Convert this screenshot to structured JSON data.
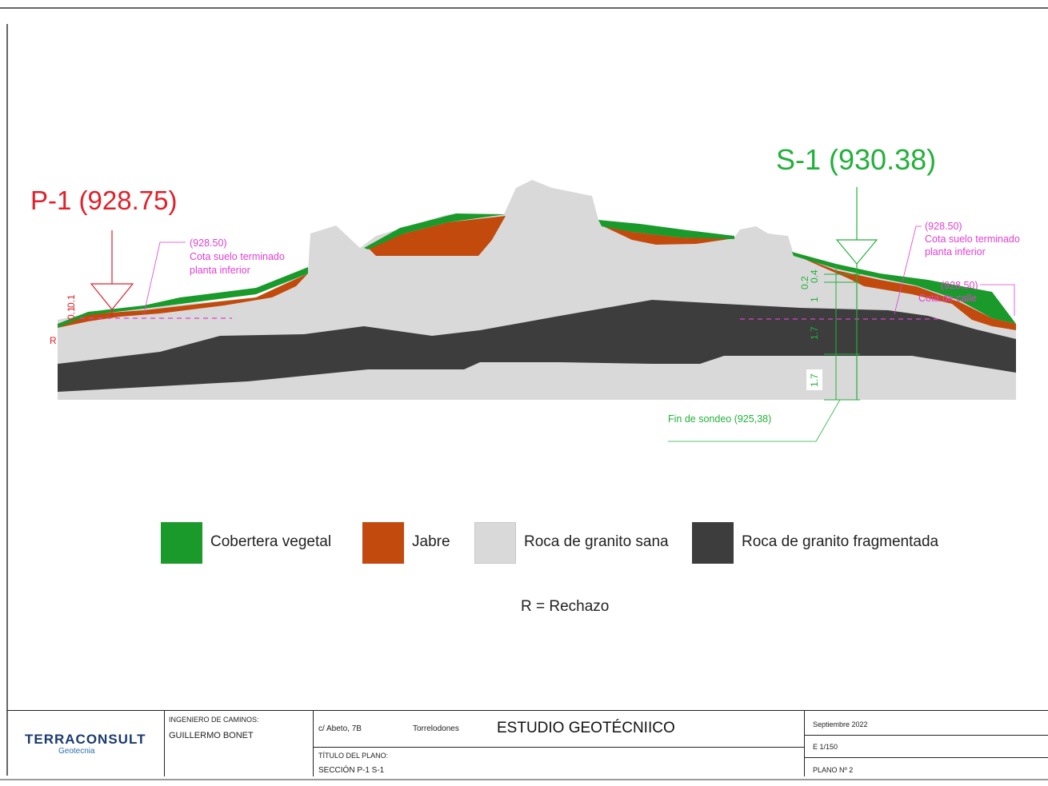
{
  "labels": {
    "p1": "P-1 (928.75)",
    "s1": "S-1 (930.38)",
    "left_cota_value": "(928.50)",
    "left_cota_line1": "Cota suelo terminado",
    "left_cota_line2": "planta inferior",
    "right_cota_value": "(928.50)",
    "right_cota_line1": "Cota suelo terminado",
    "right_cota_line2": "planta inferior",
    "calle_value": "(928.50)",
    "calle_text": "Cota de calle",
    "fin_sondeo": "Fin de sondeo (925,38)",
    "rechazo_marker": "R",
    "p1_dim_a": "0.1",
    "p1_dim_b": "0.1",
    "s1_dims": [
      "0.2",
      "0.4",
      "1",
      "1.7",
      "1.7"
    ]
  },
  "legend": [
    {
      "label": "Cobertera vegetal",
      "color": "#1a9a2a"
    },
    {
      "label": "Jabre",
      "color": "#c24a0c"
    },
    {
      "label": "Roca de granito sana",
      "color": "#d9d9d9"
    },
    {
      "label": "Roca de granito fragmentada",
      "color": "#3d3d3d"
    }
  ],
  "note": "R = Rechazo",
  "title_block": {
    "logo": "TERRACONSULT",
    "logo_sub": "Geotecnia",
    "engineer_label": "INGENIERO DE CAMINOS:",
    "engineer_name": "GUILLERMO BONET",
    "address": "c/  Abeto, 7B",
    "city": "Torrelodones",
    "project": "ESTUDIO GEOTÉCNIICO",
    "plan_title_label": "TÍTULO DEL PLANO:",
    "plan_title": "SECCIÓN P-1 S-1",
    "date": "Septiembre 2022",
    "scale": "E 1/150",
    "plan_number": "PLANO Nº 2"
  },
  "colors": {
    "vegetal": "#1a9a2a",
    "jabre": "#c24a0c",
    "granito_sana": "#d9d9d9",
    "granito_fragmentada": "#3d3d3d",
    "p1_red": "#e0202a",
    "s1_green": "#22b03a",
    "annotation_magenta": "#e040d0"
  }
}
